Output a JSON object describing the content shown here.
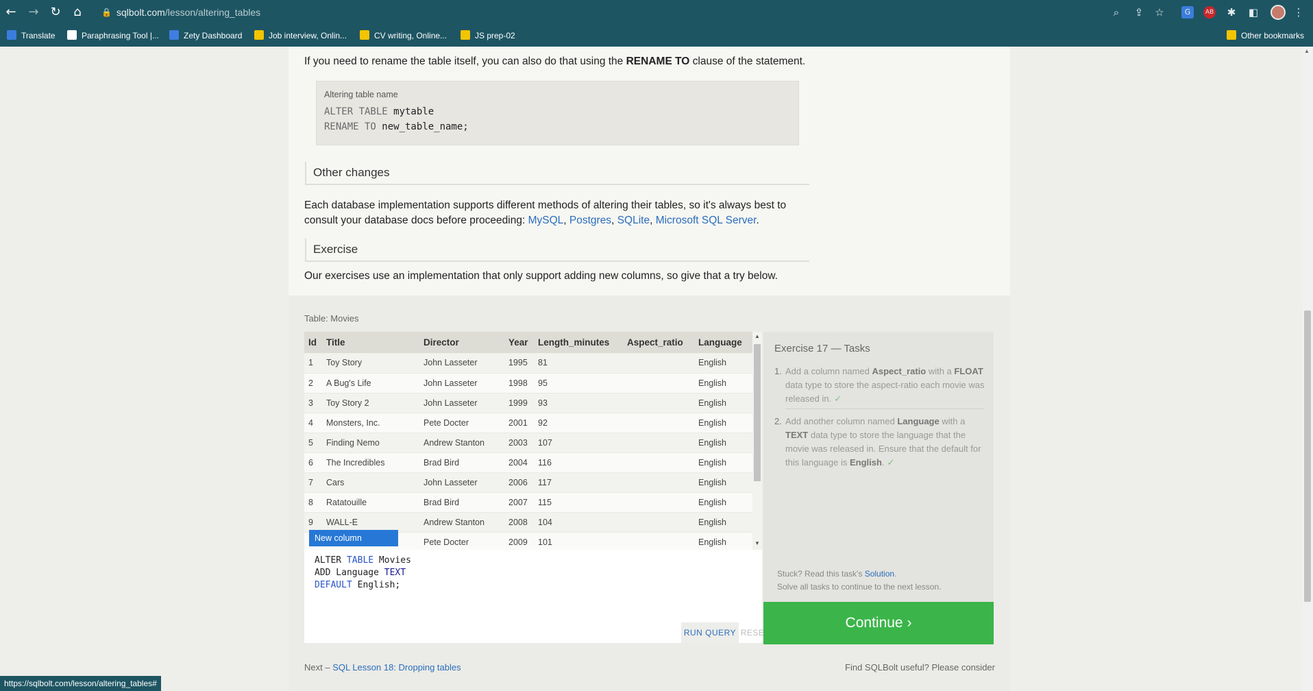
{
  "browser": {
    "url_domain": "sqlbolt.com",
    "url_path": "/lesson/altering_tables",
    "bookmarks": [
      {
        "label": "Translate",
        "color": "#3b7ddd"
      },
      {
        "label": "Paraphrasing Tool |...",
        "color": "#ffffff"
      },
      {
        "label": "Zety Dashboard",
        "color": "#3f7ee0"
      },
      {
        "label": "Job interview, Onlin...",
        "color": "#f3c400"
      },
      {
        "label": "CV writing, Online...",
        "color": "#f3c400"
      },
      {
        "label": "JS prep-02",
        "color": "#f3c400"
      }
    ],
    "other_bookmarks": "Other bookmarks",
    "status_url": "https://sqlbolt.com/lesson/altering_tables#"
  },
  "intro": {
    "before": "If you need to rename the table itself, you can also do that using the ",
    "bold": "RENAME TO",
    "after": " clause of the statement."
  },
  "code_example": {
    "caption": "Altering table name",
    "line1_kw": "ALTER TABLE",
    "line1_name": " mytable",
    "line2_kw": "RENAME TO",
    "line2_name": " new_table_name;"
  },
  "other_changes": {
    "heading": "Other changes",
    "text1": "Each database implementation supports different methods of altering their tables, so it's always best to",
    "text2": "consult your database docs before proceeding: ",
    "links": [
      "MySQL",
      "Postgres",
      "SQLite",
      "Microsoft SQL Server"
    ]
  },
  "exercise": {
    "heading": "Exercise",
    "text": "Our exercises use an implementation that only support adding new columns, so give that a try below."
  },
  "table": {
    "caption": "Table: Movies",
    "columns": [
      "Id",
      "Title",
      "Director",
      "Year",
      "Length_minutes",
      "Aspect_ratio",
      "Language"
    ],
    "rows": [
      [
        "1",
        "Toy Story",
        "John Lasseter",
        "1995",
        "81",
        "",
        "English"
      ],
      [
        "2",
        "A Bug's Life",
        "John Lasseter",
        "1998",
        "95",
        "",
        "English"
      ],
      [
        "3",
        "Toy Story 2",
        "John Lasseter",
        "1999",
        "93",
        "",
        "English"
      ],
      [
        "4",
        "Monsters, Inc.",
        "Pete Docter",
        "2001",
        "92",
        "",
        "English"
      ],
      [
        "5",
        "Finding Nemo",
        "Andrew Stanton",
        "2003",
        "107",
        "",
        "English"
      ],
      [
        "6",
        "The Incredibles",
        "Brad Bird",
        "2004",
        "116",
        "",
        "English"
      ],
      [
        "7",
        "Cars",
        "John Lasseter",
        "2006",
        "117",
        "",
        "English"
      ],
      [
        "8",
        "Ratatouille",
        "Brad Bird",
        "2007",
        "115",
        "",
        "English"
      ],
      [
        "9",
        "WALL-E",
        "Andrew Stanton",
        "2008",
        "104",
        "",
        "English"
      ],
      [
        "",
        "",
        "Pete Docter",
        "2009",
        "101",
        "",
        "English"
      ]
    ],
    "new_column_label": "New column"
  },
  "editor": {
    "l1a": "ALTER ",
    "l1b": "TABLE",
    "l1c": " Movies",
    "l2a": "ADD Language ",
    "l2b": "TEXT",
    "l3a": "DEFAULT",
    "l3b": " English;",
    "run_label": "RUN QUERY",
    "reset_label": "RESET"
  },
  "tasks": {
    "title": "Exercise 17 — Tasks",
    "items": [
      {
        "num": "1.",
        "a": "Add a column named ",
        "b1": "Aspect_ratio",
        "c": " with a ",
        "b2": "FLOAT",
        "d": " data type to store the aspect-ratio each movie was released in.",
        "check": "✓"
      },
      {
        "num": "2.",
        "a": "Add another column named ",
        "b1": "Language",
        "c": " with a ",
        "b2": "TEXT",
        "d": " data type to store the language that the movie was released in. Ensure that the default for this language is ",
        "b3": "English",
        "e": ".",
        "check": "✓"
      }
    ],
    "stuck_text": "Stuck? Read this task's ",
    "stuck_link": "Solution",
    "stuck_end": ".",
    "solve_text": "Solve all tasks to continue to the next lesson.",
    "continue_label": "Continue ›"
  },
  "footer": {
    "next_prefix": "Next – ",
    "next_link": "SQL Lesson 18: Dropping tables",
    "useful_text": "Find SQLBolt useful? Please consider"
  }
}
